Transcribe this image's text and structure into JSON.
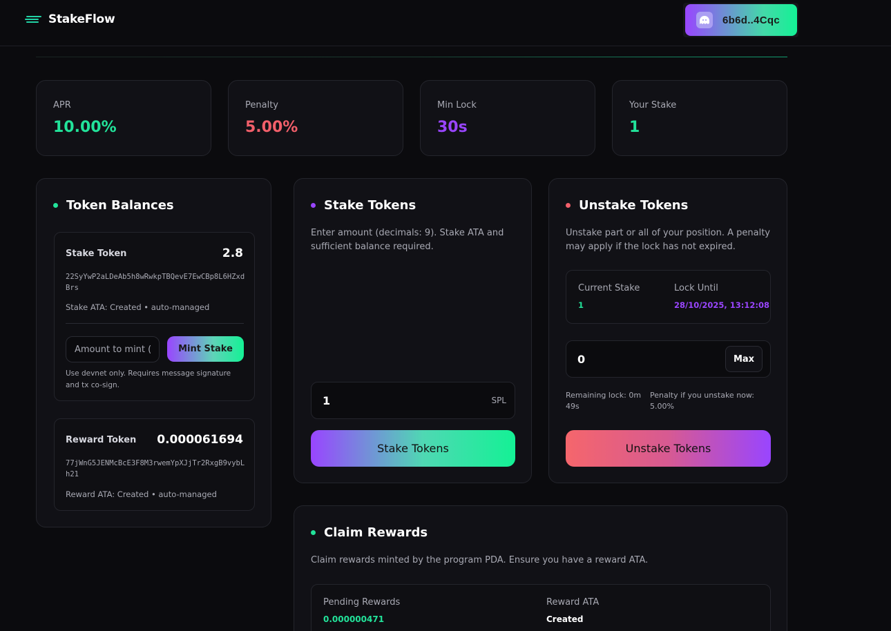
{
  "app": {
    "name": "StakeFlow",
    "wallet": "6b6d..4Cqc"
  },
  "stats": [
    {
      "label": "APR",
      "value": "10.00%",
      "color": "#22e39a"
    },
    {
      "label": "Penalty",
      "value": "5.00%",
      "color": "#f25f6a"
    },
    {
      "label": "Min Lock",
      "value": "30s",
      "color": "#9945ff"
    },
    {
      "label": "Your Stake",
      "value": "1",
      "color": "#22e39a"
    }
  ],
  "balances": {
    "title": "Token Balances",
    "stake": {
      "name": "Stake Token",
      "amount": "2.8",
      "address": "22SyYwP2aLDeAb5h8wRwkpTBQevE7EwCBp8L6HZxdBrs",
      "ata": "Stake ATA: Created • auto-managed"
    },
    "mint": {
      "placeholder": "Amount to mint (Intercept)",
      "button": "Mint Stake",
      "note": "Use devnet only. Requires message signature and tx co-sign."
    },
    "reward": {
      "name": "Reward Token",
      "amount": "0.000061694",
      "address": "77jWnG5JENMcBcE3F8M3rwemYpXJjTr2RxgB9vybLh21",
      "ata": "Reward ATA: Created • auto-managed"
    }
  },
  "stake": {
    "title": "Stake Tokens",
    "desc": "Enter amount (decimals: 9). Stake ATA and sufficient balance required.",
    "amount": "1",
    "unit": "SPL",
    "button": "Stake Tokens"
  },
  "unstake": {
    "title": "Unstake Tokens",
    "desc": "Unstake part or all of your position. A penalty may apply if the lock has not expired.",
    "current_label": "Current Stake",
    "current_value": "1",
    "lock_label": "Lock Until",
    "lock_value": "28/10/2025, 13:12:08",
    "amount": "0",
    "max": "Max",
    "remaining": "Remaining lock: 0m 49s",
    "penalty_now": "Penalty if you unstake now: 5.00%",
    "button": "Unstake Tokens"
  },
  "claim": {
    "title": "Claim Rewards",
    "desc": "Claim rewards minted by the program PDA. Ensure you have a reward ATA.",
    "pending_label": "Pending Rewards",
    "pending_value": "0.000000471",
    "ata_label": "Reward ATA",
    "ata_value": "Created"
  },
  "colors": {
    "green": "#22e39a",
    "purple": "#9945ff",
    "red": "#f25f6a"
  }
}
